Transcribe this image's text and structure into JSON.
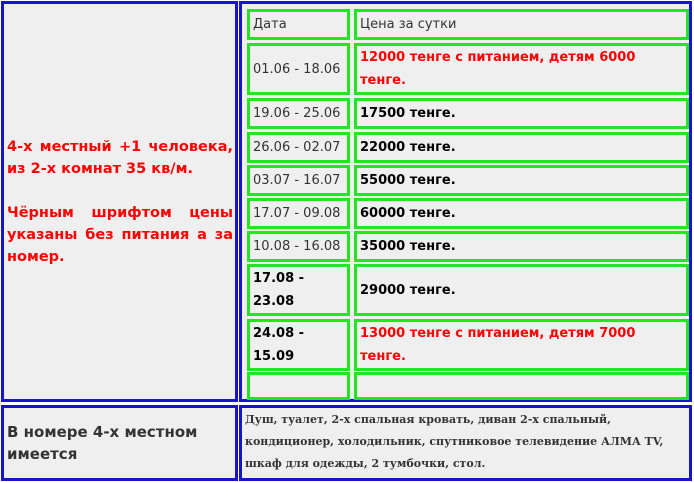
{
  "description": {
    "line1": "4-х местный +1 человека, из 2-х комнат 35 кв/м.",
    "line2": "Чёрным шрифтом цены указаны без питания а за номер."
  },
  "table": {
    "headers": {
      "date": "Дата",
      "price": "Цена за сутки"
    },
    "rows": [
      {
        "date": "01.06 - 18.06",
        "price": "12000 тенге с питанием, детям 6000 тенге."
      },
      {
        "date": "19.06 - 25.06",
        "price": "17500 тенге."
      },
      {
        "date": "26.06 - 02.07",
        "price": "22000 тенге."
      },
      {
        "date": "03.07 - 16.07",
        "price": "55000 тенге."
      },
      {
        "date": "17.07 - 09.08",
        "price": "60000 тенге."
      },
      {
        "date": "10.08 - 16.08",
        "price": "35000 тенге."
      },
      {
        "date": "17.08 - 23.08",
        "price": "29000 тенге."
      },
      {
        "date": "24.08 - 15.09",
        "price": "13000 тенге с питанием, детям 7000 тенге."
      },
      {
        "date": "",
        "price": ""
      }
    ]
  },
  "amenities": {
    "label": "В номере 4-х местном имеется",
    "text": "Душ, туалет, 2-х спальная кровать, диван 2-х спальный, кондиционер, холодильник, спутниковое телевидение АЛМА TV, шкаф для одежды, 2 тумбочки, стол."
  },
  "colors": {
    "outer_border": "#1616c8",
    "inner_border": "#22e622",
    "highlight_text": "#ff0000",
    "cell_background": "#efefef"
  }
}
